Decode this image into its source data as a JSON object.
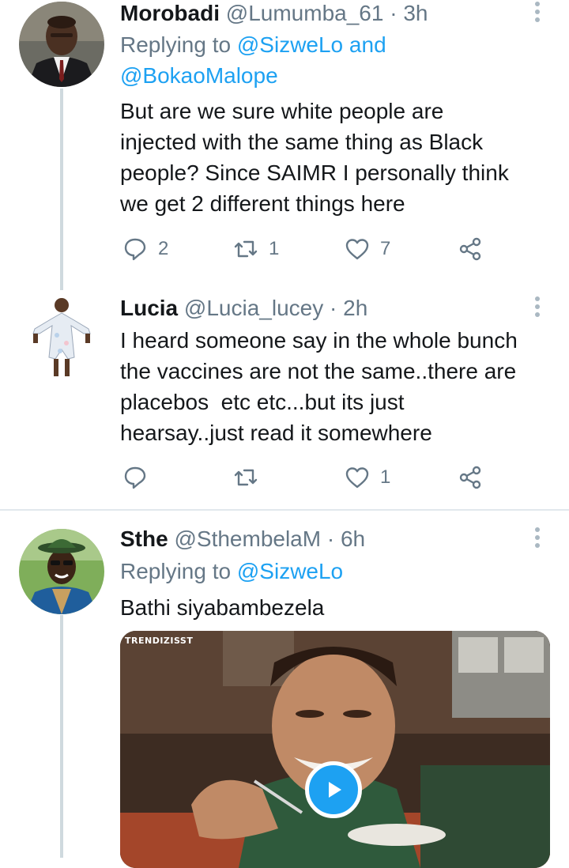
{
  "tweets": [
    {
      "name": "Morobadi",
      "handle": "@Lumumba_61",
      "separator": " · ",
      "time": "3h",
      "replying_prefix": "Replying to ",
      "reply_mentions": [
        "@SizweLo",
        "and",
        "@BokaoMalope"
      ],
      "text_lines": [
        "But are we sure white people are",
        "injected with the same thing as Black",
        "people? Since SAIMR I personally think",
        "we get 2 different things here"
      ],
      "reply_count": "2",
      "retweet_count": "1",
      "like_count": "7"
    },
    {
      "name": "Lucia",
      "handle": "@Lucia_lucey",
      "separator": " · ",
      "time": "2h",
      "text_lines": [
        "I heard someone say in the whole bunch",
        "the vaccines are not the same..there are",
        "placebos  etc etc...but its just",
        "hearsay..just read it somewhere"
      ],
      "reply_count": "",
      "retweet_count": "",
      "like_count": "1"
    },
    {
      "name": "Sthe",
      "handle": "@SthembelaM",
      "separator": " · ",
      "time": "6h",
      "replying_prefix": "Replying to ",
      "reply_mentions": [
        "@SizweLo"
      ],
      "text_lines": [
        "Bathi siyabambezela"
      ],
      "media_watermark": "TRENDIZISST"
    }
  ],
  "colors": {
    "accent": "#1da1f2",
    "secondary_text": "#657786",
    "primary_text": "#14171a",
    "thread_line": "#cfd9de",
    "divider": "#e1e8ed"
  },
  "icons": [
    "reply-icon",
    "retweet-icon",
    "like-icon",
    "share-icon",
    "more-icon",
    "play-icon"
  ]
}
